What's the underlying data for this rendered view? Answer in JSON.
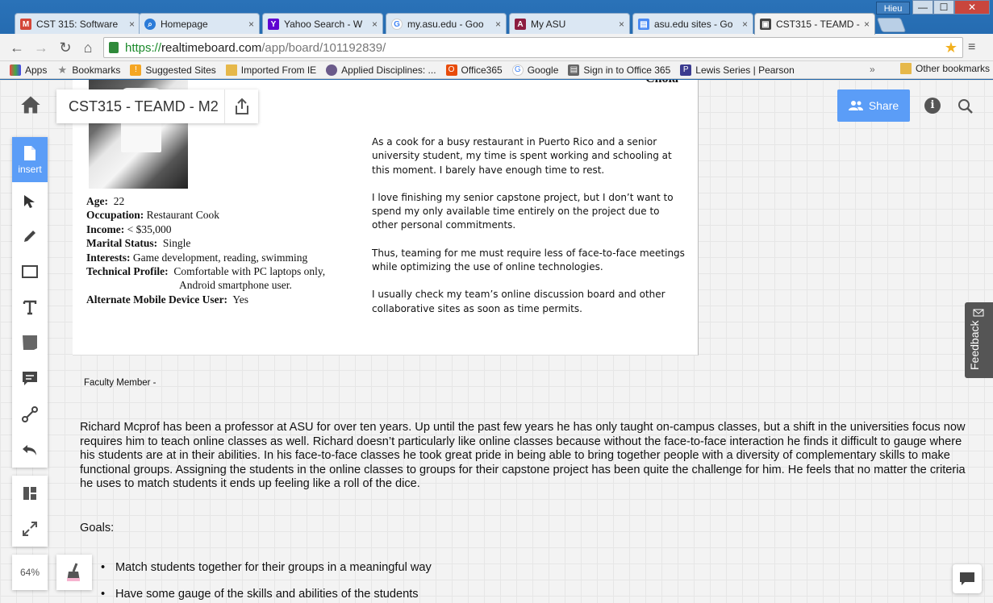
{
  "browser": {
    "user_name": "Hieu",
    "tabs": [
      {
        "title": "CST 315: Software",
        "favicon": "gmail-icon"
      },
      {
        "title": "Homepage",
        "favicon": "homepage-icon"
      },
      {
        "title": "Yahoo Search - W",
        "favicon": "yahoo-icon"
      },
      {
        "title": "my.asu.edu - Goo",
        "favicon": "google-icon"
      },
      {
        "title": "My ASU",
        "favicon": "asu-icon"
      },
      {
        "title": "asu.edu sites - Go",
        "favicon": "sites-icon"
      },
      {
        "title": "CST315 - TEAMD -",
        "favicon": "realtimeboard-icon",
        "active": true
      }
    ],
    "url": {
      "scheme": "https://",
      "host": "realtimeboard.com",
      "path": "/app/board/101192839/"
    },
    "bookmarks": [
      "Apps",
      "Bookmarks",
      "Suggested Sites",
      "Imported From IE",
      "Applied Disciplines: ...",
      "Office365",
      "Google",
      "Sign in to Office 365",
      "Lewis Series | Pearson"
    ],
    "other_bookmarks": "Other bookmarks"
  },
  "board": {
    "title": "CST315 - TEAMD - M2",
    "share_label": "Share",
    "insert_label": "insert",
    "zoom": "64%",
    "feedback_label": "Feedback"
  },
  "persona": {
    "name_fragment": "Chola",
    "facts": [
      {
        "label": "Age:",
        "value": "22"
      },
      {
        "label": "Occupation:",
        "value": "Restaurant Cook"
      },
      {
        "label": "Income:",
        "value": "< $35,000"
      },
      {
        "label": "Marital Status:",
        "value": "Single"
      },
      {
        "label": "Interests:",
        "value": "Game development, reading, swimming"
      },
      {
        "label": "Technical Profile:",
        "value": "Comfortable with PC laptops only,",
        "value2": "Android smartphone user."
      },
      {
        "label": "Alternate Mobile Device User:",
        "value": "Yes"
      }
    ],
    "bio": [
      "As a cook for a busy restaurant in Puerto Rico and a senior university student, my time is spent working and schooling at this moment. I barely have enough time to rest.",
      "I love finishing my senior capstone project, but I don’t want to spend my only available time entirely on the project due to other personal commitments.",
      "Thus, teaming for me must require less of face-to-face meetings while optimizing the use of online technologies.",
      "I usually check my team’s online discussion board and other collaborative sites as soon as time permits."
    ]
  },
  "faculty": {
    "label": "Faculty Member -",
    "description": "Richard Mcprof has been a professor at ASU for over ten years. Up until the past few years he has only taught on-campus classes, but a shift in the universities focus now requires him to teach online classes as well. Richard doesn’t particularly like online classes because without the face-to-face interaction he finds it difficult to gauge where his students are at in their abilities. In his face-to-face classes he took great pride in being able to bring together people with a diversity of complementary skills to make functional groups. Assigning the students in the online classes to groups for their capstone project has been quite the challenge for him. He feels that no matter the criteria he uses to match students it ends up feeling like a roll of the dice.",
    "goals_label": "Goals:",
    "goals": [
      "Match students together for their groups in a meaningful way",
      "Have some gauge of the skills and abilities of the students"
    ]
  },
  "colors": {
    "accent": "#5b9df7",
    "chrome_blue": "#1e63a8",
    "dark_tab": "#555555"
  }
}
